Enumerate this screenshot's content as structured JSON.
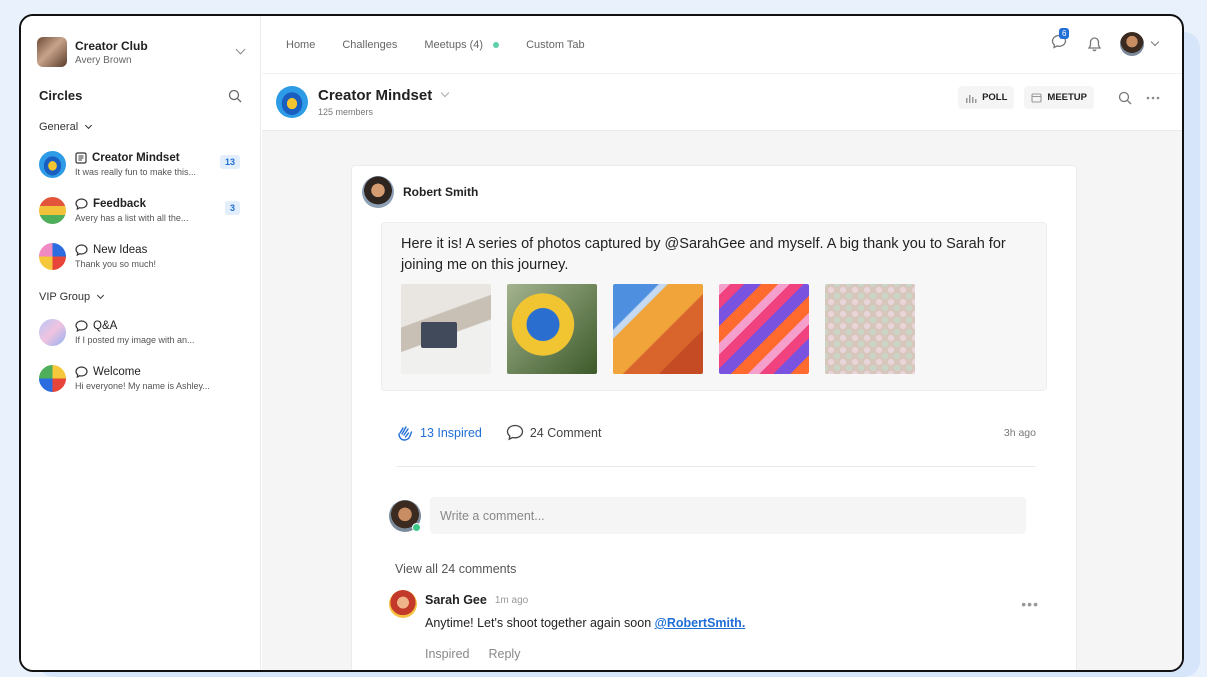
{
  "workspace": {
    "name": "Creator Club",
    "user": "Avery Brown"
  },
  "sidebar": {
    "title": "Circles",
    "sections": [
      {
        "label": "General"
      },
      {
        "label": "VIP Group"
      }
    ],
    "items": [
      {
        "title": "Creator Mindset",
        "subtitle": "It was really fun to make this...",
        "badge": "13"
      },
      {
        "title": "Feedback",
        "subtitle": "Avery has a list with all the...",
        "badge": "3"
      },
      {
        "title": "New Ideas",
        "subtitle": "Thank you so much!"
      },
      {
        "title": "Q&A",
        "subtitle": "If I posted my image with an..."
      },
      {
        "title": "Welcome",
        "subtitle": "Hi everyone! My name is Ashley..."
      }
    ]
  },
  "topnav": {
    "items": [
      "Home",
      "Challenges",
      "Meetups (4)",
      "Custom Tab"
    ],
    "message_badge": "6"
  },
  "channel": {
    "title": "Creator Mindset",
    "members": "125 members",
    "poll_label": "POLL",
    "meetup_label": "MEETUP"
  },
  "post": {
    "author": "Robert Smith",
    "text": "Here it is! A series of photos captured by @SarahGee and myself. A big thank you to Sarah for joining me on this journey.",
    "inspired_label": "13 Inspired",
    "comment_label": "24 Comment",
    "time": "3h ago",
    "comment_placeholder": "Write a comment...",
    "view_all": "View all 24 comments"
  },
  "comment": {
    "author": "Sarah Gee",
    "time": "1m ago",
    "text": "Anytime! Let's shoot together again soon ",
    "mention": "@RobertSmith.",
    "inspired_label": "Inspired",
    "reply_label": "Reply"
  },
  "colors": {
    "accent": "#1f6fd6",
    "online": "#3cc98a",
    "meetup_dot": "#5fd0a8"
  }
}
